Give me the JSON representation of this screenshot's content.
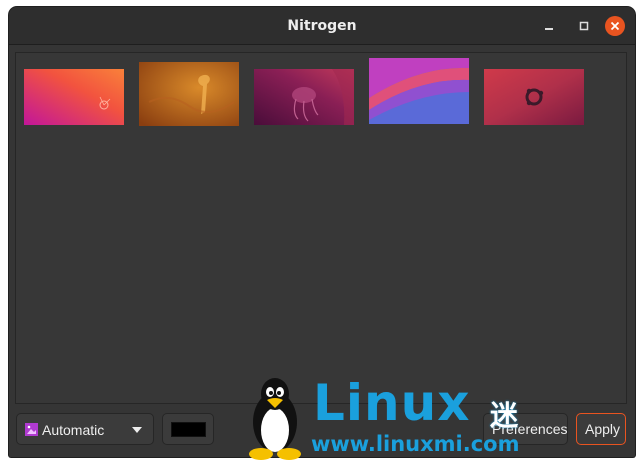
{
  "window": {
    "title": "Nitrogen",
    "controls": {
      "minimize": "minimize-icon",
      "maximize": "maximize-icon",
      "close": "close-icon"
    }
  },
  "wallpapers": [
    {
      "name": "wallpaper-1"
    },
    {
      "name": "wallpaper-2"
    },
    {
      "name": "wallpaper-3"
    },
    {
      "name": "wallpaper-4"
    },
    {
      "name": "wallpaper-5"
    }
  ],
  "toolbar": {
    "mode_label": "Automatic",
    "mode_icon": "image-icon",
    "bg_color": "#000000",
    "preferences_label": "Preferences",
    "apply_label": "Apply"
  },
  "watermark": {
    "brand": "Linux",
    "brand_cn": "迷",
    "url": "www.linuxmi.com"
  },
  "colors": {
    "accent": "#e95420",
    "window_bg": "#353535",
    "brand": "#1aa0dd"
  }
}
